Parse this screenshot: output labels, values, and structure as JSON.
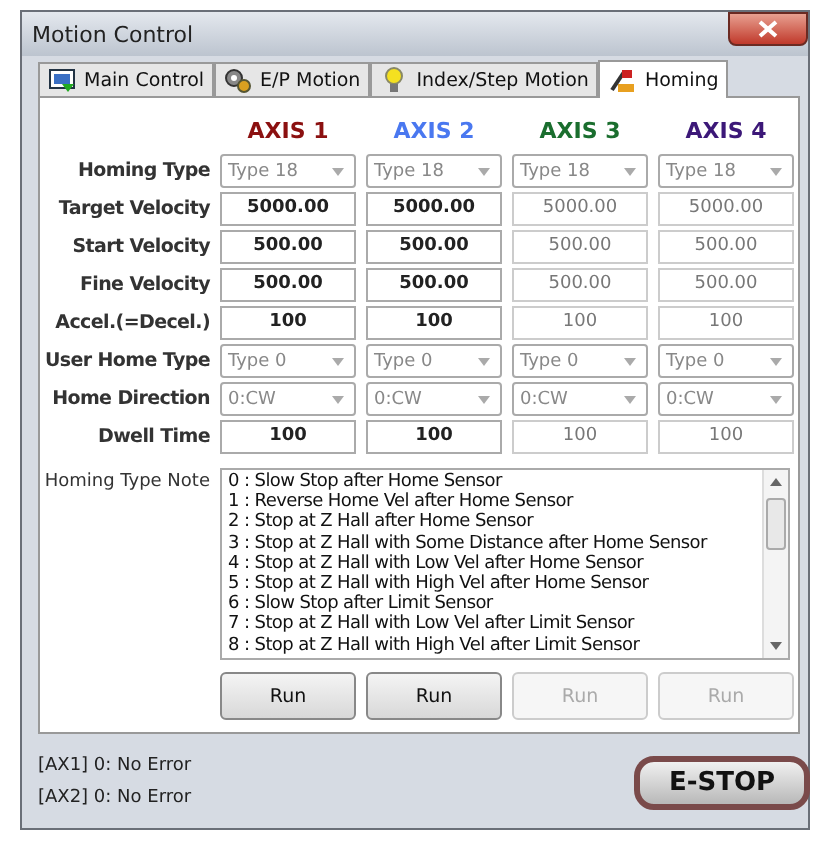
{
  "window": {
    "title": "Motion Control"
  },
  "tabs": [
    {
      "label": "Main Control",
      "selected": false,
      "kind": "monitor"
    },
    {
      "label": "E/P Motion",
      "selected": false,
      "kind": "gears"
    },
    {
      "label": "Index/Step Motion",
      "selected": false,
      "kind": "bulb"
    },
    {
      "label": "Homing",
      "selected": true,
      "kind": "tools"
    }
  ],
  "axes": [
    {
      "label": "AXIS 1",
      "color": "#8b1010"
    },
    {
      "label": "AXIS 2",
      "color": "#4a78f0"
    },
    {
      "label": "AXIS 3",
      "color": "#1a6e2e"
    },
    {
      "label": "AXIS 4",
      "color": "#3c1878"
    }
  ],
  "rows": [
    {
      "label": "Homing Type",
      "kind": "select",
      "cells": [
        {
          "value": "Type 18",
          "disabled": true
        },
        {
          "value": "Type 18",
          "disabled": true
        },
        {
          "value": "Type 18",
          "disabled": true
        },
        {
          "value": "Type 18",
          "disabled": true
        }
      ]
    },
    {
      "label": "Target Velocity",
      "kind": "input",
      "cells": [
        {
          "value": "5000.00",
          "disabled": false
        },
        {
          "value": "5000.00",
          "disabled": false
        },
        {
          "value": "5000.00",
          "disabled": true
        },
        {
          "value": "5000.00",
          "disabled": true
        }
      ]
    },
    {
      "label": "Start Velocity",
      "kind": "input",
      "cells": [
        {
          "value": "500.00",
          "disabled": false
        },
        {
          "value": "500.00",
          "disabled": false
        },
        {
          "value": "500.00",
          "disabled": true
        },
        {
          "value": "500.00",
          "disabled": true
        }
      ]
    },
    {
      "label": "Fine Velocity",
      "kind": "input",
      "cells": [
        {
          "value": "500.00",
          "disabled": false
        },
        {
          "value": "500.00",
          "disabled": false
        },
        {
          "value": "500.00",
          "disabled": true
        },
        {
          "value": "500.00",
          "disabled": true
        }
      ]
    },
    {
      "label": "Accel.(=Decel.)",
      "kind": "input",
      "cells": [
        {
          "value": "100",
          "disabled": false
        },
        {
          "value": "100",
          "disabled": false
        },
        {
          "value": "100",
          "disabled": true
        },
        {
          "value": "100",
          "disabled": true
        }
      ]
    },
    {
      "label": "User Home Type",
      "kind": "select",
      "cells": [
        {
          "value": "Type 0",
          "disabled": true
        },
        {
          "value": "Type 0",
          "disabled": true
        },
        {
          "value": "Type 0",
          "disabled": true
        },
        {
          "value": "Type 0",
          "disabled": true
        }
      ]
    },
    {
      "label": "Home Direction",
      "kind": "select",
      "cells": [
        {
          "value": "0:CW",
          "disabled": true
        },
        {
          "value": "0:CW",
          "disabled": true
        },
        {
          "value": "0:CW",
          "disabled": true
        },
        {
          "value": "0:CW",
          "disabled": true
        }
      ]
    },
    {
      "label": "Dwell Time",
      "kind": "input",
      "cells": [
        {
          "value": "100",
          "disabled": false
        },
        {
          "value": "100",
          "disabled": false
        },
        {
          "value": "100",
          "disabled": true
        },
        {
          "value": "100",
          "disabled": true
        }
      ]
    }
  ],
  "note": {
    "label": "Homing Type Note",
    "lines": [
      "0 : Slow Stop after Home Sensor",
      "1 : Reverse Home Vel after Home Sensor",
      "2 : Stop at Z Hall after Home Sensor",
      "3 : Stop at Z Hall with Some Distance after Home Sensor",
      "4 : Stop at Z Hall with Low Vel after Home Sensor",
      "5 : Stop at Z Hall with High Vel after Home Sensor",
      "6 : Slow Stop after Limit Sensor",
      "7 : Stop at Z Hall with Low Vel after Limit Sensor",
      "8 : Stop at Z Hall with High Vel after Limit Sensor"
    ]
  },
  "run_buttons": [
    {
      "label": "Run",
      "disabled": false
    },
    {
      "label": "Run",
      "disabled": false
    },
    {
      "label": "Run",
      "disabled": true
    },
    {
      "label": "Run",
      "disabled": true
    }
  ],
  "status_lines": [
    "[AX1] 0: No Error",
    "[AX2] 0: No Error"
  ],
  "estop": {
    "label": "E-STOP"
  }
}
